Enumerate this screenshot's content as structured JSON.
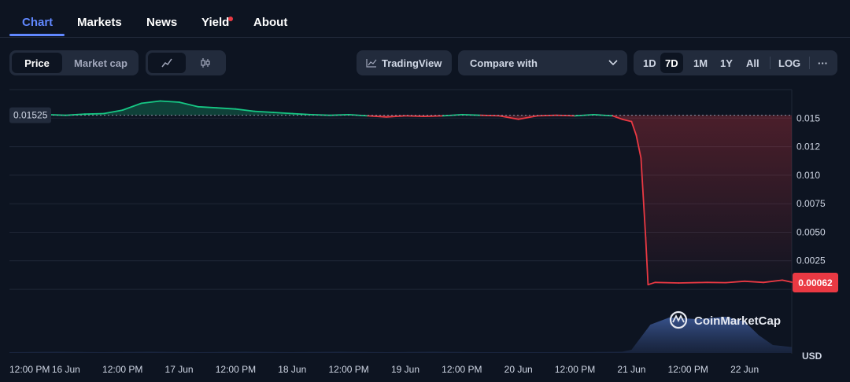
{
  "tabs": [
    {
      "label": "Chart",
      "active": true
    },
    {
      "label": "Markets"
    },
    {
      "label": "News"
    },
    {
      "label": "Yield",
      "badge": true
    },
    {
      "label": "About"
    }
  ],
  "toolbar": {
    "price_label": "Price",
    "market_cap_label": "Market cap",
    "line_icon": "line-chart-icon",
    "candle_icon": "candlestick-icon",
    "tradingview_label": "TradingView",
    "tradingview_icon": "chart-line-icon",
    "compare_label": "Compare with",
    "compare_icon": "chevron-down-icon",
    "ranges": [
      "1D",
      "7D",
      "1M",
      "1Y",
      "All"
    ],
    "active_range": "7D",
    "log_label": "LOG",
    "more_label": "···"
  },
  "colors": {
    "up": "#16c784",
    "down": "#ea3943",
    "accent": "#6188ff",
    "background": "#0d1421"
  },
  "watermark": "CoinMarketCap",
  "chart_data": {
    "type": "line",
    "currency": "USD",
    "open_price_label": "0.01525",
    "open_price": 0.01525,
    "current_price_label": "0.00062",
    "current_price": 0.00062,
    "ylim": [
      0,
      0.0175
    ],
    "y_ticks": [
      {
        "value": 0.015,
        "label": "0.015"
      },
      {
        "value": 0.0125,
        "label": "0.012"
      },
      {
        "value": 0.01,
        "label": "0.010"
      },
      {
        "value": 0.0075,
        "label": "0.0075"
      },
      {
        "value": 0.005,
        "label": "0.0050"
      },
      {
        "value": 0.0025,
        "label": "0.0025"
      }
    ],
    "x_range": [
      0,
      166
    ],
    "x_ticks": [
      {
        "t": 0,
        "label": "12:00 PM"
      },
      {
        "t": 12,
        "label": "16 Jun"
      },
      {
        "t": 24,
        "label": "12:00 PM"
      },
      {
        "t": 36,
        "label": "17 Jun"
      },
      {
        "t": 48,
        "label": "12:00 PM"
      },
      {
        "t": 60,
        "label": "18 Jun"
      },
      {
        "t": 72,
        "label": "12:00 PM"
      },
      {
        "t": 84,
        "label": "19 Jun"
      },
      {
        "t": 96,
        "label": "12:00 PM"
      },
      {
        "t": 108,
        "label": "20 Jun"
      },
      {
        "t": 120,
        "label": "12:00 PM"
      },
      {
        "t": 132,
        "label": "21 Jun"
      },
      {
        "t": 144,
        "label": "12:00 PM"
      },
      {
        "t": 156,
        "label": "22 Jun"
      }
    ],
    "price_points": [
      [
        4,
        0.01525
      ],
      [
        8,
        0.0153
      ],
      [
        12,
        0.01525
      ],
      [
        16,
        0.01535
      ],
      [
        20,
        0.0154
      ],
      [
        24,
        0.0157
      ],
      [
        28,
        0.0163
      ],
      [
        32,
        0.0165
      ],
      [
        36,
        0.0164
      ],
      [
        40,
        0.016
      ],
      [
        44,
        0.0159
      ],
      [
        48,
        0.0158
      ],
      [
        52,
        0.0156
      ],
      [
        56,
        0.0155
      ],
      [
        60,
        0.0154
      ],
      [
        64,
        0.0153
      ],
      [
        68,
        0.01525
      ],
      [
        72,
        0.0153
      ],
      [
        76,
        0.0152
      ],
      [
        80,
        0.0151
      ],
      [
        84,
        0.0152
      ],
      [
        88,
        0.01515
      ],
      [
        92,
        0.0152
      ],
      [
        96,
        0.0153
      ],
      [
        100,
        0.01525
      ],
      [
        104,
        0.0152
      ],
      [
        108,
        0.0149
      ],
      [
        112,
        0.0152
      ],
      [
        116,
        0.01525
      ],
      [
        120,
        0.0152
      ],
      [
        124,
        0.0153
      ],
      [
        128,
        0.0152
      ],
      [
        130,
        0.0149
      ],
      [
        132,
        0.0147
      ],
      [
        133,
        0.0135
      ],
      [
        134,
        0.0115
      ],
      [
        135,
        0.0045
      ],
      [
        135.5,
        0.0004
      ],
      [
        137,
        0.0006
      ],
      [
        142,
        0.00055
      ],
      [
        148,
        0.0006
      ],
      [
        152,
        0.00058
      ],
      [
        156,
        0.0007
      ],
      [
        160,
        0.0006
      ],
      [
        164,
        0.0008
      ],
      [
        166,
        0.00062
      ]
    ],
    "volume_points": [
      [
        0,
        0.02
      ],
      [
        10,
        0.03
      ],
      [
        20,
        0.02
      ],
      [
        30,
        0.03
      ],
      [
        40,
        0.02
      ],
      [
        50,
        0.03
      ],
      [
        60,
        0.02
      ],
      [
        70,
        0.03
      ],
      [
        80,
        0.02
      ],
      [
        90,
        0.03
      ],
      [
        100,
        0.02
      ],
      [
        110,
        0.02
      ],
      [
        120,
        0.02
      ],
      [
        130,
        0.03
      ],
      [
        132,
        0.08
      ],
      [
        134,
        0.4
      ],
      [
        136,
        0.72
      ],
      [
        140,
        0.9
      ],
      [
        146,
        0.86
      ],
      [
        152,
        0.92
      ],
      [
        156,
        0.8
      ],
      [
        159,
        0.45
      ],
      [
        162,
        0.2
      ],
      [
        166,
        0.15
      ]
    ]
  }
}
